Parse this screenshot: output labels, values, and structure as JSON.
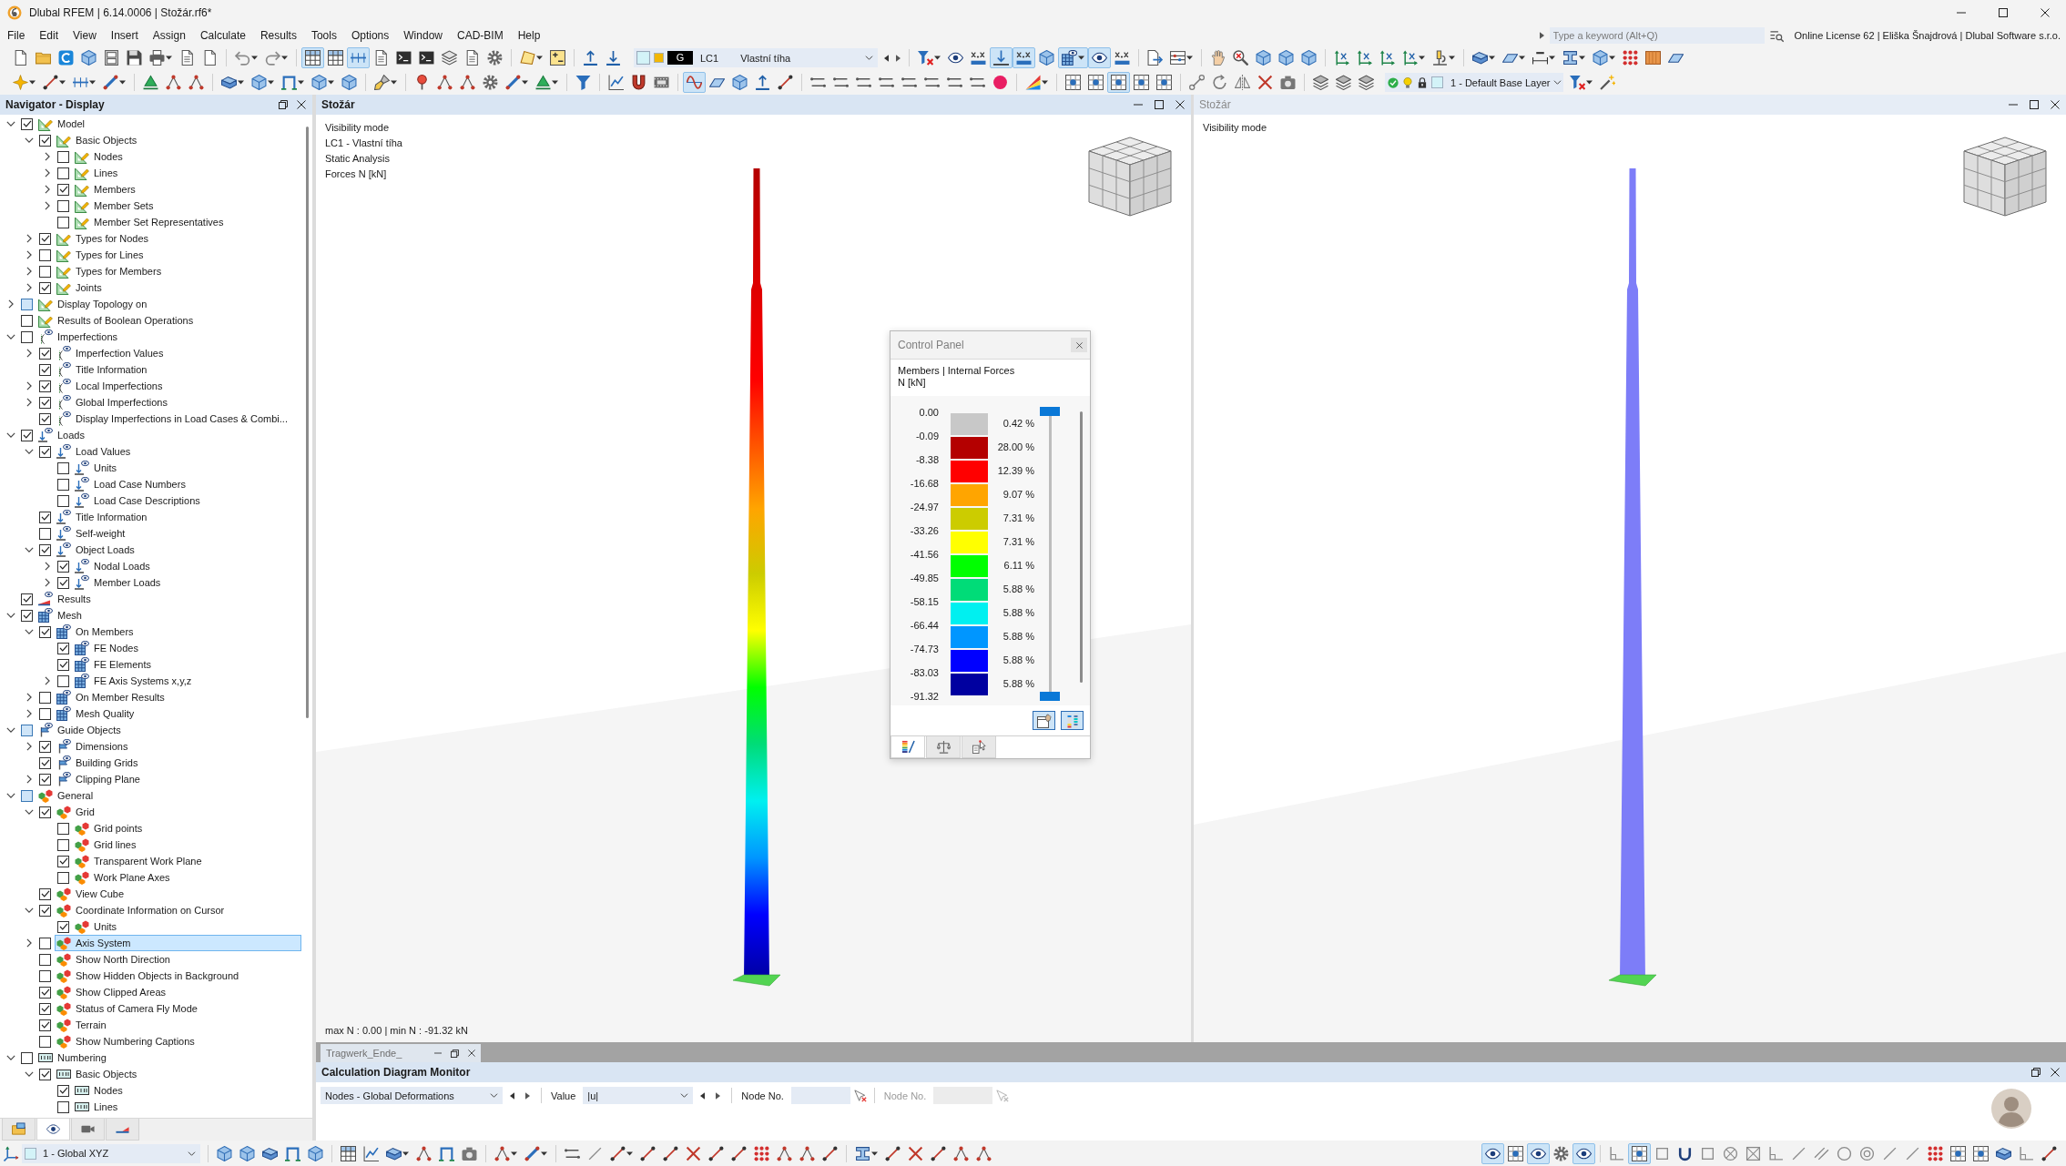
{
  "window": {
    "title": "Dlubal RFEM | 6.14.0006 | Stožár.rf6*"
  },
  "menu": [
    "File",
    "Edit",
    "View",
    "Insert",
    "Assign",
    "Calculate",
    "Results",
    "Tools",
    "Options",
    "Window",
    "CAD-BIM",
    "Help"
  ],
  "search": {
    "placeholder": "Type a keyword (Alt+Q)"
  },
  "license": "Online License 62 | Eliška Šnajdrová | Dlubal Software s.r.o.",
  "toolbar_1": {
    "left_groups": [
      {
        "buttons": [
          {
            "dropdown": false,
            "pressed": false
          },
          {
            "dropdown": false,
            "pressed": false
          },
          {
            "dropdown": false,
            "pressed": false
          },
          {
            "dropdown": false,
            "pressed": false
          },
          {
            "dropdown": false,
            "pressed": false
          },
          {
            "dropdown": false,
            "pressed": false
          },
          {
            "dropdown": true,
            "pressed": false
          },
          {
            "dropdown": false,
            "pressed": false
          },
          {
            "dropdown": false,
            "pressed": false
          }
        ]
      },
      {
        "buttons": [
          {
            "dropdown": true,
            "pressed": false
          },
          {
            "dropdown": true,
            "pressed": false
          }
        ]
      },
      {
        "buttons": [
          {
            "dropdown": false,
            "pressed": true
          },
          {
            "dropdown": false,
            "pressed": false
          },
          {
            "dropdown": false,
            "pressed": true
          },
          {
            "dropdown": false,
            "pressed": false
          },
          {
            "dropdown": false,
            "pressed": false
          },
          {
            "dropdown": false,
            "pressed": false
          },
          {
            "dropdown": false,
            "pressed": false
          },
          {
            "dropdown": false,
            "pressed": false
          },
          {
            "dropdown": false,
            "pressed": false
          }
        ]
      },
      {
        "buttons": [
          {
            "dropdown": true,
            "pressed": false
          },
          {
            "dropdown": false,
            "pressed": false
          }
        ]
      },
      {
        "buttons": [
          {
            "dropdown": false,
            "pressed": false
          },
          {
            "dropdown": false,
            "pressed": false
          }
        ]
      }
    ],
    "load_case": {
      "category": "G",
      "number": "LC1",
      "name": "Vlastní tíha"
    },
    "right_groups": [
      {
        "buttons": [
          {
            "dropdown": true,
            "pressed": false
          },
          {
            "dropdown": false,
            "pressed": false
          },
          {
            "dropdown": false,
            "pressed": false
          },
          {
            "dropdown": false,
            "pressed": true
          },
          {
            "dropdown": false,
            "pressed": true
          },
          {
            "dropdown": false,
            "pressed": false
          },
          {
            "dropdown": true,
            "pressed": true
          },
          {
            "dropdown": false,
            "pressed": true
          },
          {
            "dropdown": false,
            "pressed": false
          }
        ]
      },
      {
        "buttons": [
          {
            "dropdown": false,
            "pressed": false
          },
          {
            "dropdown": true,
            "pressed": false
          }
        ]
      },
      {
        "buttons": [
          {
            "dropdown": false,
            "pressed": false
          },
          {
            "dropdown": false,
            "pressed": false
          },
          {
            "dropdown": false,
            "pressed": false
          },
          {
            "dropdown": false,
            "pressed": false
          },
          {
            "dropdown": false,
            "pressed": false
          }
        ]
      },
      {
        "buttons": [
          {
            "dropdown": false,
            "pressed": false
          },
          {
            "dropdown": false,
            "pressed": false
          },
          {
            "dropdown": false,
            "pressed": false
          },
          {
            "dropdown": true,
            "pressed": false
          },
          {
            "dropdown": true,
            "pressed": false
          }
        ]
      },
      {
        "buttons": [
          {
            "dropdown": true,
            "pressed": false
          },
          {
            "dropdown": true,
            "pressed": false
          },
          {
            "dropdown": true,
            "pressed": false
          },
          {
            "dropdown": true,
            "pressed": false
          },
          {
            "dropdown": true,
            "pressed": false
          },
          {
            "dropdown": false,
            "pressed": false
          },
          {
            "dropdown": false,
            "pressed": false
          },
          {
            "dropdown": false,
            "pressed": false
          }
        ]
      }
    ]
  },
  "toolbar_2": {
    "left_groups": [
      {
        "buttons": [
          {
            "dropdown": true,
            "pressed": false
          },
          {
            "dropdown": true,
            "pressed": false
          },
          {
            "dropdown": true,
            "pressed": false
          },
          {
            "dropdown": true,
            "pressed": false
          }
        ]
      },
      {
        "buttons": [
          {
            "dropdown": false,
            "pressed": false
          },
          {
            "dropdown": false,
            "pressed": false
          },
          {
            "dropdown": false,
            "pressed": false
          }
        ]
      },
      {
        "buttons": [
          {
            "dropdown": true,
            "pressed": false
          },
          {
            "dropdown": true,
            "pressed": false
          },
          {
            "dropdown": true,
            "pressed": false
          },
          {
            "dropdown": true,
            "pressed": false
          },
          {
            "dropdown": false,
            "pressed": false
          }
        ]
      },
      {
        "buttons": [
          {
            "dropdown": true,
            "pressed": false
          }
        ]
      },
      {
        "buttons": [
          {
            "dropdown": false,
            "pressed": false
          },
          {
            "dropdown": false,
            "pressed": false
          },
          {
            "dropdown": false,
            "pressed": false
          },
          {
            "dropdown": false,
            "pressed": false
          },
          {
            "dropdown": true,
            "pressed": false
          },
          {
            "dropdown": true,
            "pressed": false
          }
        ]
      },
      {
        "buttons": [
          {
            "dropdown": false,
            "pressed": false
          }
        ]
      },
      {
        "buttons": [
          {
            "dropdown": false,
            "pressed": false
          },
          {
            "dropdown": false,
            "pressed": false
          },
          {
            "dropdown": false,
            "pressed": false
          }
        ]
      },
      {
        "buttons": [
          {
            "dropdown": false,
            "pressed": true
          },
          {
            "dropdown": false,
            "pressed": false
          },
          {
            "dropdown": false,
            "pressed": false
          },
          {
            "dropdown": false,
            "pressed": false
          },
          {
            "dropdown": false,
            "pressed": false
          }
        ]
      },
      {
        "buttons": [
          {
            "dropdown": false,
            "pressed": false
          },
          {
            "dropdown": false,
            "pressed": false
          },
          {
            "dropdown": false,
            "pressed": false
          },
          {
            "dropdown": false,
            "pressed": false
          },
          {
            "dropdown": false,
            "pressed": false
          },
          {
            "dropdown": false,
            "pressed": false
          },
          {
            "dropdown": false,
            "pressed": false
          },
          {
            "dropdown": false,
            "pressed": false
          },
          {
            "dropdown": false,
            "pressed": false
          }
        ]
      },
      {
        "buttons": [
          {
            "dropdown": true,
            "pressed": false
          }
        ]
      },
      {
        "buttons": [
          {
            "dropdown": false,
            "pressed": false
          },
          {
            "dropdown": false,
            "pressed": false
          },
          {
            "dropdown": false,
            "pressed": true
          },
          {
            "dropdown": false,
            "pressed": false
          },
          {
            "dropdown": false,
            "pressed": false
          }
        ]
      },
      {
        "buttons": [
          {
            "dropdown": false,
            "pressed": false
          },
          {
            "dropdown": false,
            "pressed": false
          },
          {
            "dropdown": false,
            "pressed": false
          },
          {
            "dropdown": false,
            "pressed": false
          },
          {
            "dropdown": false,
            "pressed": false
          }
        ]
      },
      {
        "buttons": [
          {
            "dropdown": false,
            "pressed": false
          },
          {
            "dropdown": false,
            "pressed": false
          },
          {
            "dropdown": false,
            "pressed": false
          }
        ]
      }
    ],
    "layer": {
      "name": "1 - Default Base Layer"
    },
    "right_groups": [
      {
        "buttons": [
          {
            "dropdown": true,
            "pressed": false
          },
          {
            "dropdown": false,
            "pressed": false
          }
        ]
      }
    ]
  },
  "navigator": {
    "title": "Navigator - Display",
    "tree": [
      {
        "label": "Model",
        "kind": "model",
        "checked": true,
        "mixed": false,
        "selected": false,
        "expanded": true,
        "children": [
          {
            "label": "Basic Objects",
            "checked": true,
            "mixed": false,
            "selected": false,
            "expanded": true,
            "children": [
              {
                "label": "Nodes",
                "checked": false,
                "mixed": false,
                "selected": false,
                "expanded": false
              },
              {
                "label": "Lines",
                "checked": false,
                "mixed": false,
                "selected": false,
                "expanded": false
              },
              {
                "label": "Members",
                "checked": true,
                "mixed": false,
                "selected": false,
                "expanded": false
              },
              {
                "label": "Member Sets",
                "checked": false,
                "mixed": false,
                "selected": false,
                "expanded": false
              },
              {
                "label": "Member Set Representatives",
                "checked": false,
                "mixed": false,
                "selected": false
              }
            ]
          },
          {
            "label": "Types for Nodes",
            "checked": true,
            "mixed": false,
            "selected": false,
            "expanded": false
          },
          {
            "label": "Types for Lines",
            "checked": false,
            "mixed": false,
            "selected": false,
            "expanded": false
          },
          {
            "label": "Types for Members",
            "checked": false,
            "mixed": false,
            "selected": false,
            "expanded": false
          },
          {
            "label": "Joints",
            "checked": true,
            "mixed": false,
            "selected": false,
            "expanded": false
          }
        ]
      },
      {
        "label": "Display Topology on",
        "kind": "model",
        "checked": false,
        "mixed": true,
        "selected": false,
        "expanded": false
      },
      {
        "label": "Results of Boolean Operations",
        "kind": "model",
        "checked": false,
        "mixed": false,
        "selected": false
      },
      {
        "label": "Imperfections",
        "kind": "imperfections",
        "checked": false,
        "mixed": false,
        "selected": false,
        "expanded": true,
        "children": [
          {
            "label": "Imperfection Values",
            "checked": true,
            "mixed": false,
            "selected": false,
            "expanded": false
          },
          {
            "label": "Title Information",
            "checked": true,
            "mixed": false,
            "selected": false
          },
          {
            "label": "Local Imperfections",
            "checked": true,
            "mixed": false,
            "selected": false,
            "expanded": false
          },
          {
            "label": "Global Imperfections",
            "checked": true,
            "mixed": false,
            "selected": false,
            "expanded": false
          },
          {
            "label": "Display Imperfections in Load Cases & Combi...",
            "checked": true,
            "mixed": false,
            "selected": false
          }
        ]
      },
      {
        "label": "Loads",
        "kind": "loads",
        "checked": true,
        "mixed": false,
        "selected": false,
        "expanded": true,
        "children": [
          {
            "label": "Load Values",
            "checked": true,
            "mixed": false,
            "selected": false,
            "expanded": true,
            "children": [
              {
                "label": "Units",
                "checked": false,
                "mixed": false,
                "selected": false
              },
              {
                "label": "Load Case Numbers",
                "checked": false,
                "mixed": false,
                "selected": false
              },
              {
                "label": "Load Case Descriptions",
                "checked": false,
                "mixed": false,
                "selected": false
              }
            ]
          },
          {
            "label": "Title Information",
            "checked": true,
            "mixed": false,
            "selected": false
          },
          {
            "label": "Self-weight",
            "checked": false,
            "mixed": false,
            "selected": false
          },
          {
            "label": "Object Loads",
            "checked": true,
            "mixed": false,
            "selected": false,
            "expanded": true,
            "children": [
              {
                "label": "Nodal Loads",
                "checked": true,
                "mixed": false,
                "selected": false,
                "expanded": false
              },
              {
                "label": "Member Loads",
                "checked": true,
                "mixed": false,
                "selected": false,
                "expanded": false
              }
            ]
          }
        ]
      },
      {
        "label": "Results",
        "kind": "results",
        "checked": true,
        "mixed": false,
        "selected": false
      },
      {
        "label": "Mesh",
        "kind": "mesh",
        "checked": true,
        "mixed": false,
        "selected": false,
        "expanded": true,
        "children": [
          {
            "label": "On Members",
            "checked": true,
            "mixed": false,
            "selected": false,
            "expanded": true,
            "children": [
              {
                "label": "FE Nodes",
                "checked": true,
                "mixed": false,
                "selected": false
              },
              {
                "label": "FE Elements",
                "checked": true,
                "mixed": false,
                "selected": false
              },
              {
                "label": "FE Axis Systems x,y,z",
                "checked": false,
                "mixed": false,
                "selected": false,
                "expanded": false
              }
            ]
          },
          {
            "label": "On Member Results",
            "checked": false,
            "mixed": false,
            "selected": false,
            "expanded": false
          },
          {
            "label": "Mesh Quality",
            "checked": false,
            "mixed": false,
            "selected": false,
            "expanded": false
          }
        ]
      },
      {
        "label": "Guide Objects",
        "kind": "guide",
        "checked": false,
        "mixed": true,
        "selected": false,
        "expanded": true,
        "children": [
          {
            "label": "Dimensions",
            "checked": true,
            "mixed": false,
            "selected": false,
            "expanded": false
          },
          {
            "label": "Building Grids",
            "checked": true,
            "mixed": false,
            "selected": false
          },
          {
            "label": "Clipping Plane",
            "checked": true,
            "mixed": false,
            "selected": false,
            "expanded": false
          }
        ]
      },
      {
        "label": "General",
        "kind": "general",
        "checked": false,
        "mixed": true,
        "selected": false,
        "expanded": true,
        "children": [
          {
            "label": "Grid",
            "checked": true,
            "mixed": false,
            "selected": false,
            "expanded": true,
            "children": [
              {
                "label": "Grid points",
                "checked": false,
                "mixed": false,
                "selected": false
              },
              {
                "label": "Grid lines",
                "checked": false,
                "mixed": false,
                "selected": false
              },
              {
                "label": "Transparent Work Plane",
                "checked": true,
                "mixed": false,
                "selected": false
              },
              {
                "label": "Work Plane Axes",
                "checked": false,
                "mixed": false,
                "selected": false
              }
            ]
          },
          {
            "label": "View Cube",
            "checked": true,
            "mixed": false,
            "selected": false
          },
          {
            "label": "Coordinate Information on Cursor",
            "checked": true,
            "mixed": false,
            "selected": false,
            "expanded": true,
            "children": [
              {
                "label": "Units",
                "checked": true,
                "mixed": false,
                "selected": false
              }
            ]
          },
          {
            "label": "Axis System",
            "checked": false,
            "mixed": false,
            "selected": true,
            "expanded": false
          },
          {
            "label": "Show North Direction",
            "checked": false,
            "mixed": false,
            "selected": false
          },
          {
            "label": "Show Hidden Objects in Background",
            "checked": false,
            "mixed": false,
            "selected": false
          },
          {
            "label": "Show Clipped Areas",
            "checked": true,
            "mixed": false,
            "selected": false
          },
          {
            "label": "Status of Camera Fly Mode",
            "checked": true,
            "mixed": false,
            "selected": false
          },
          {
            "label": "Terrain",
            "checked": true,
            "mixed": false,
            "selected": false
          },
          {
            "label": "Show Numbering Captions",
            "checked": false,
            "mixed": false,
            "selected": false
          }
        ]
      },
      {
        "label": "Numbering",
        "kind": "numbering",
        "checked": false,
        "mixed": false,
        "selected": false,
        "expanded": true,
        "children": [
          {
            "label": "Basic Objects",
            "checked": true,
            "mixed": false,
            "selected": false,
            "expanded": true,
            "children": [
              {
                "label": "Nodes",
                "checked": true,
                "mixed": false,
                "selected": false
              },
              {
                "label": "Lines",
                "checked": false,
                "mixed": false,
                "selected": false
              }
            ]
          }
        ]
      }
    ],
    "tabs": [
      {
        "selected": false
      },
      {
        "selected": true
      },
      {
        "selected": false
      },
      {
        "selected": false
      }
    ]
  },
  "views": [
    {
      "title": "Stožár",
      "active": true,
      "kind": "result",
      "info": [
        "Visibility mode",
        "LC1 - Vlastní tíha",
        "Static Analysis",
        "Forces N [kN]"
      ],
      "summary": "max N : 0.00 | min N : -91.32 kN"
    },
    {
      "title": "Stožár",
      "active": false,
      "kind": "model",
      "info": [
        "Visibility mode"
      ]
    }
  ],
  "control_panel": {
    "title": "Control Panel",
    "heading": "Members | Internal Forces",
    "unit": "N [kN]",
    "scale_values": [
      "0.00",
      "-0.09",
      "-8.38",
      "-16.68",
      "-24.97",
      "-33.26",
      "-41.56",
      "-49.85",
      "-58.15",
      "-66.44",
      "-74.73",
      "-83.03",
      "-91.32"
    ],
    "bands": [
      {
        "color": "#c8c8c8",
        "share": "0.42 %"
      },
      {
        "color": "#b40000",
        "share": "28.00 %"
      },
      {
        "color": "#ff0000",
        "share": "12.39 %"
      },
      {
        "color": "#ffa500",
        "share": "9.07 %"
      },
      {
        "color": "#cccc00",
        "share": "7.31 %"
      },
      {
        "color": "#ffff00",
        "share": "7.31 %"
      },
      {
        "color": "#00ff00",
        "share": "6.11 %"
      },
      {
        "color": "#00dc78",
        "share": "5.88 %"
      },
      {
        "color": "#00f0f0",
        "share": "5.88 %"
      },
      {
        "color": "#0096ff",
        "share": "5.88 %"
      },
      {
        "color": "#0000ff",
        "share": "5.88 %"
      },
      {
        "color": "#0000a0",
        "share": "5.88 %"
      }
    ],
    "range": {
      "level": 1
    },
    "buttons": [
      {
        "pressed": true
      },
      {
        "pressed": true
      }
    ],
    "tabs": [
      {
        "selected": true
      },
      {
        "selected": false
      },
      {
        "selected": false
      }
    ]
  },
  "minimized_windows": [
    {
      "title": "Tragwerk_Ende_"
    }
  ],
  "diagram_monitor": {
    "title": "Calculation Diagram Monitor",
    "type_select": "Nodes - Global Deformations",
    "value_label": "Value",
    "value_select": "|u|",
    "node_fields": [
      {
        "label": "Node No.",
        "disabled": false
      },
      {
        "label": "Node No.",
        "disabled": true
      }
    ]
  },
  "bottom_toolbar": {
    "coordinate_system": "1 - Global XYZ",
    "left_groups": [
      {
        "buttons": [
          {
            "dropdown": false,
            "pressed": false
          },
          {
            "dropdown": false,
            "pressed": false
          },
          {
            "dropdown": false,
            "pressed": false
          },
          {
            "dropdown": false,
            "pressed": false
          },
          {
            "dropdown": false,
            "pressed": false
          }
        ]
      },
      {
        "buttons": [
          {
            "dropdown": false,
            "pressed": false
          },
          {
            "dropdown": false,
            "pressed": false
          },
          {
            "dropdown": true,
            "pressed": false
          },
          {
            "dropdown": false,
            "pressed": false
          },
          {
            "dropdown": false,
            "pressed": false
          },
          {
            "dropdown": false,
            "pressed": false
          }
        ]
      },
      {
        "buttons": [
          {
            "dropdown": true,
            "pressed": false
          },
          {
            "dropdown": true,
            "pressed": false
          }
        ]
      },
      {
        "buttons": [
          {
            "dropdown": false,
            "pressed": false
          },
          {
            "dropdown": false,
            "pressed": false
          },
          {
            "dropdown": true,
            "pressed": false
          },
          {
            "dropdown": false,
            "pressed": false
          },
          {
            "dropdown": false,
            "pressed": false
          },
          {
            "dropdown": false,
            "pressed": false
          },
          {
            "dropdown": false,
            "pressed": false
          },
          {
            "dropdown": false,
            "pressed": false
          },
          {
            "dropdown": false,
            "pressed": false
          },
          {
            "dropdown": false,
            "pressed": false
          },
          {
            "dropdown": false,
            "pressed": false
          },
          {
            "dropdown": false,
            "pressed": false
          }
        ]
      },
      {
        "buttons": [
          {
            "dropdown": true,
            "pressed": false
          },
          {
            "dropdown": false,
            "pressed": false
          },
          {
            "dropdown": false,
            "pressed": false
          },
          {
            "dropdown": false,
            "pressed": false
          },
          {
            "dropdown": false,
            "pressed": false
          },
          {
            "dropdown": false,
            "pressed": false
          }
        ]
      }
    ],
    "right_groups": [
      {
        "buttons": [
          {
            "dropdown": false,
            "pressed": true
          },
          {
            "dropdown": false,
            "pressed": false
          },
          {
            "dropdown": false,
            "pressed": true
          },
          {
            "dropdown": false,
            "pressed": false
          },
          {
            "dropdown": false,
            "pressed": true
          }
        ]
      },
      {
        "buttons": [
          {
            "dropdown": false,
            "pressed": false
          },
          {
            "dropdown": false,
            "pressed": true
          },
          {
            "dropdown": false,
            "pressed": false
          },
          {
            "dropdown": false,
            "pressed": false
          },
          {
            "dropdown": false,
            "pressed": false
          },
          {
            "dropdown": false,
            "pressed": false
          },
          {
            "dropdown": false,
            "pressed": false
          },
          {
            "dropdown": false,
            "pressed": false
          },
          {
            "dropdown": false,
            "pressed": false
          },
          {
            "dropdown": false,
            "pressed": false
          },
          {
            "dropdown": false,
            "pressed": false
          },
          {
            "dropdown": false,
            "pressed": false
          },
          {
            "dropdown": false,
            "pressed": false
          },
          {
            "dropdown": false,
            "pressed": false
          },
          {
            "dropdown": false,
            "pressed": false
          },
          {
            "dropdown": false,
            "pressed": false
          },
          {
            "dropdown": false,
            "pressed": false
          },
          {
            "dropdown": false,
            "pressed": false
          },
          {
            "dropdown": false,
            "pressed": false
          },
          {
            "dropdown": false,
            "pressed": false
          }
        ]
      }
    ]
  }
}
